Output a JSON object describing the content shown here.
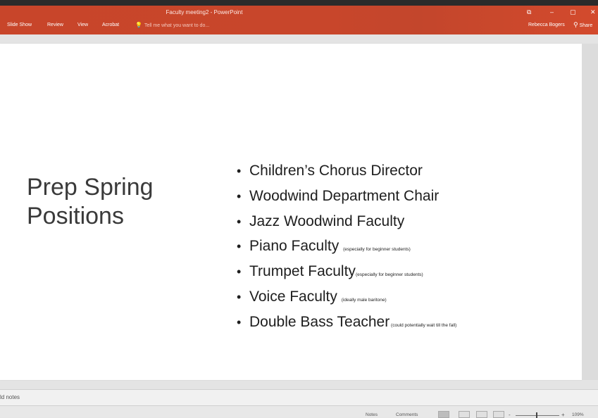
{
  "window": {
    "title": "Faculty meeting2 - PowerPoint",
    "controls": {
      "restore": "⧉",
      "minimize": "–",
      "maximize": "▢",
      "close": "✕"
    }
  },
  "ribbon": {
    "tabs": [
      "Slide Show",
      "Review",
      "View",
      "Acrobat"
    ],
    "tell_me": "Tell me what you want to do...",
    "user": "Rebecca Bogers",
    "share": "Share"
  },
  "slide": {
    "title_lines": [
      "Prep Spring",
      "Positions"
    ],
    "bullet_char": "•",
    "bullets": [
      {
        "text": "Children’s Chorus Director",
        "note": ""
      },
      {
        "text": "Woodwind Department Chair",
        "note": ""
      },
      {
        "text": "Jazz Woodwind Faculty",
        "note": ""
      },
      {
        "text": "Piano Faculty ",
        "note": "(especially for beginner students)"
      },
      {
        "text": "Trumpet Faculty",
        "note": "(especially for beginner students)"
      },
      {
        "text": "Voice Faculty ",
        "note": "(ideally male baritone)"
      },
      {
        "text": "Double Bass Teacher",
        "note": " (could potentially wait till the fall)"
      }
    ]
  },
  "notes_pane": {
    "placeholder": "ld notes"
  },
  "status_bar": {
    "notes": "Notes",
    "comments": "Comments",
    "zoom_minus": "-",
    "zoom_plus": "+",
    "zoom_level": "109%"
  }
}
